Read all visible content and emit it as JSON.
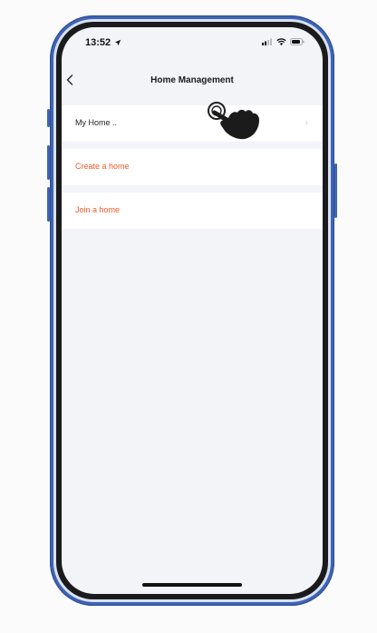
{
  "status_bar": {
    "time": "13:52",
    "icons": [
      "location-arrow-icon",
      "cellular-signal-icon",
      "wifi-icon",
      "battery-icon"
    ]
  },
  "nav": {
    "back_icon": "chevron-left-icon",
    "title": "Home Management"
  },
  "list": {
    "my_home_label": "My Home ..",
    "create_home_label": "Create a home",
    "join_home_label": "Join a home"
  },
  "colors": {
    "accent": "#f05a28",
    "frame": "#3f63b4",
    "screen_bg": "#f2f4f8"
  },
  "overlay": {
    "cursor_icon": "hand-pointer-icon"
  }
}
